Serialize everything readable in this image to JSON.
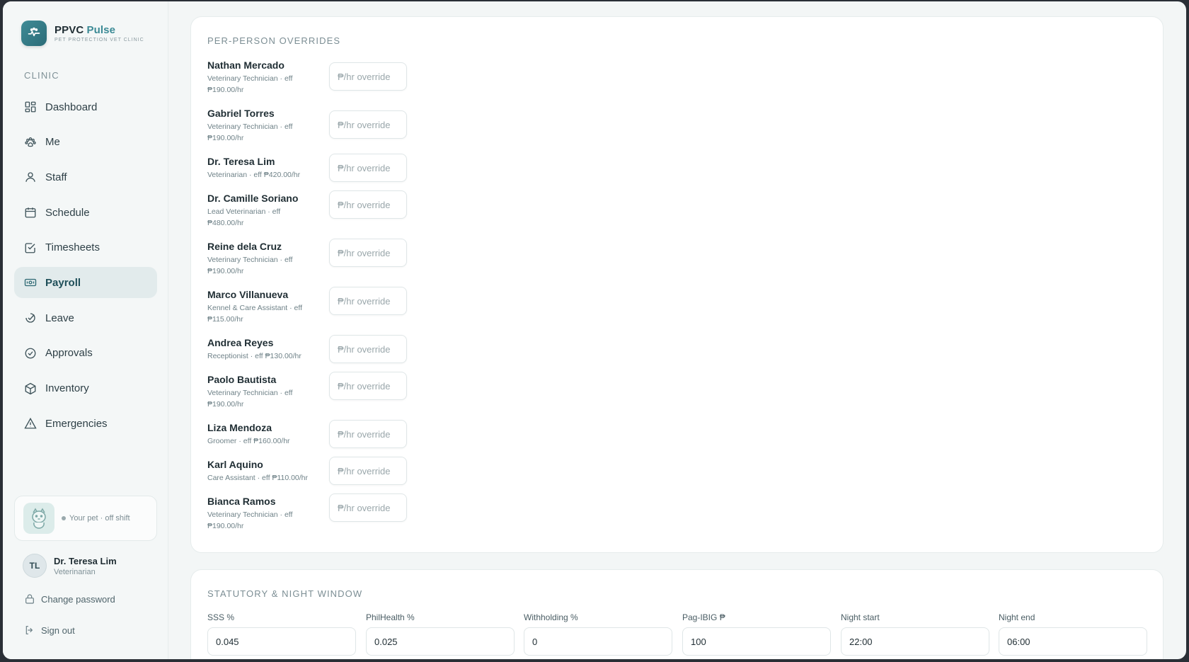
{
  "brand": {
    "name": "PPVC",
    "name_accent": "Pulse",
    "subtitle": "PET PROTECTION VET CLINIC"
  },
  "sidebar": {
    "section_label": "CLINIC",
    "items": [
      {
        "label": "Dashboard",
        "icon": "dashboard-icon"
      },
      {
        "label": "Me",
        "icon": "paw-icon"
      },
      {
        "label": "Staff",
        "icon": "person-icon"
      },
      {
        "label": "Schedule",
        "icon": "calendar-icon"
      },
      {
        "label": "Timesheets",
        "icon": "checkbox-icon"
      },
      {
        "label": "Payroll",
        "icon": "money-icon",
        "active": true
      },
      {
        "label": "Leave",
        "icon": "leave-icon"
      },
      {
        "label": "Approvals",
        "icon": "check-circle-icon"
      },
      {
        "label": "Inventory",
        "icon": "box-icon"
      },
      {
        "label": "Emergencies",
        "icon": "warning-icon"
      }
    ],
    "pet_status": "Your pet · off shift",
    "user": {
      "initials": "TL",
      "name": "Dr. Teresa Lim",
      "role": "Veterinarian"
    },
    "change_password": "Change password",
    "sign_out": "Sign out"
  },
  "overrides": {
    "title": "PER-PERSON OVERRIDES",
    "placeholder": "₱/hr override",
    "people": [
      {
        "name": "Nathan Mercado",
        "detail": "Veterinary Technician · eff ₱190.00/hr"
      },
      {
        "name": "Gabriel Torres",
        "detail": "Veterinary Technician · eff ₱190.00/hr"
      },
      {
        "name": "Dr. Teresa Lim",
        "detail": "Veterinarian · eff ₱420.00/hr"
      },
      {
        "name": "Dr. Camille Soriano",
        "detail": "Lead Veterinarian · eff ₱480.00/hr"
      },
      {
        "name": "Reine dela Cruz",
        "detail": "Veterinary Technician · eff ₱190.00/hr"
      },
      {
        "name": "Marco Villanueva",
        "detail": "Kennel & Care Assistant · eff ₱115.00/hr"
      },
      {
        "name": "Andrea Reyes",
        "detail": "Receptionist · eff ₱130.00/hr"
      },
      {
        "name": "Paolo Bautista",
        "detail": "Veterinary Technician · eff ₱190.00/hr"
      },
      {
        "name": "Liza Mendoza",
        "detail": "Groomer · eff ₱160.00/hr"
      },
      {
        "name": "Karl Aquino",
        "detail": "Care Assistant · eff ₱110.00/hr"
      },
      {
        "name": "Bianca Ramos",
        "detail": "Veterinary Technician · eff ₱190.00/hr"
      }
    ]
  },
  "statutory": {
    "title": "STATUTORY & NIGHT WINDOW",
    "fields": [
      {
        "label": "SSS %",
        "value": "0.045"
      },
      {
        "label": "PhilHealth %",
        "value": "0.025"
      },
      {
        "label": "Withholding %",
        "value": "0"
      },
      {
        "label": "Pag-IBIG ₱",
        "value": "100"
      },
      {
        "label": "Night start",
        "value": "22:00"
      },
      {
        "label": "Night end",
        "value": "06:00"
      }
    ]
  },
  "colors": {
    "accent": "#3b8a95",
    "active_bg": "#e2ebec",
    "app_bg": "#f3f6f6"
  }
}
